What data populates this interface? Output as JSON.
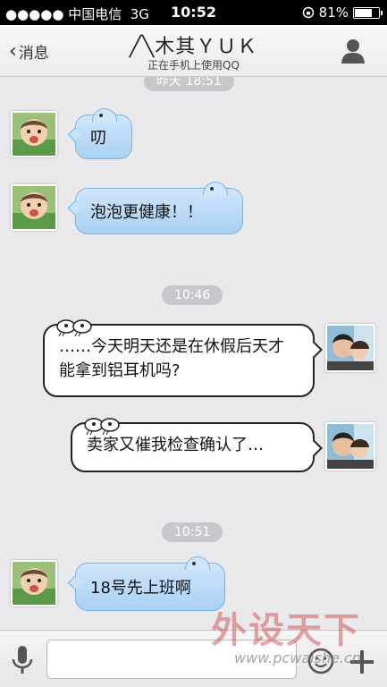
{
  "status_bar": {
    "carrier": "●●●●● 中国电信",
    "network": "3G",
    "time": "10:52",
    "battery": "81%",
    "battery_level": 0.81
  },
  "nav": {
    "back_label": "消息",
    "title": "╱╲木其ＹＵＫ",
    "subtitle": "正在手机上使用QQ",
    "profile_icon": "person-icon"
  },
  "messages": {
    "time_1": "昨天 18:51",
    "msg_1": "叨",
    "msg_2": "泡泡更健康！！",
    "time_2": "10:46",
    "msg_3": "……今天明天还是在休假后天才能拿到铝耳机吗?",
    "msg_4": "卖家又催我检查确认了…",
    "time_3": "10:51",
    "msg_5": "18号先上班啊"
  },
  "input_bar": {
    "mic_icon": "microphone-icon",
    "emoji_icon": "smiley-icon",
    "plus_icon": "plus-icon"
  },
  "watermark": {
    "text": "外设天下",
    "url": "www.pcwaishe.cn"
  },
  "colors": {
    "incoming_bubble": "#a9d1f3",
    "outgoing_bubble": "#ffffff",
    "time_pill": "#c7c8cb"
  }
}
